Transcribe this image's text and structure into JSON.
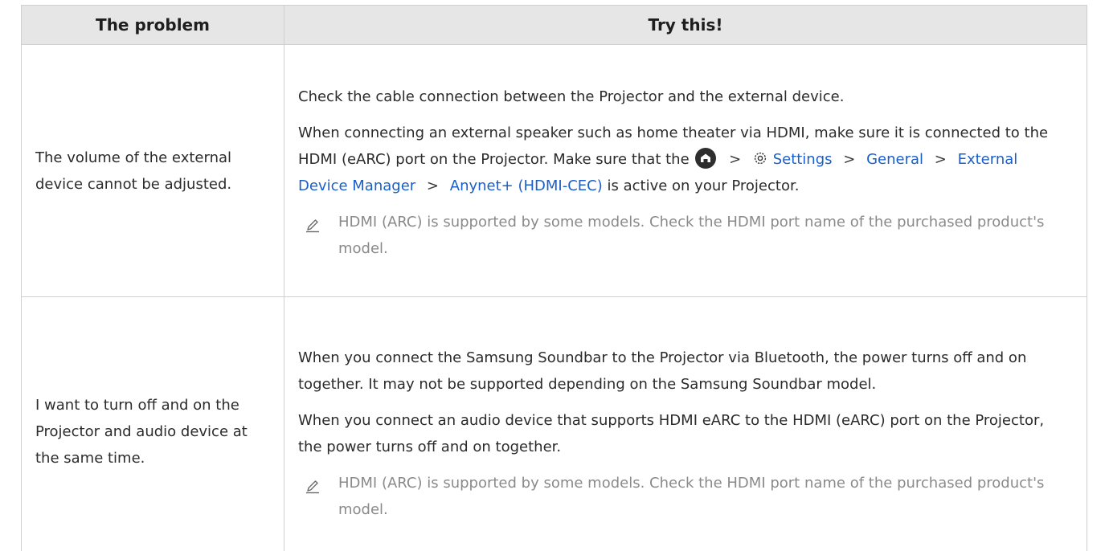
{
  "header": {
    "problem": "The problem",
    "solution": "Try this!"
  },
  "rows": [
    {
      "problem": "The volume of the external device cannot be adjusted.",
      "p1": "Check the cable connection between the Projector and the external device.",
      "p2_prefix": "When connecting an external speaker such as home theater via HDMI, make sure it is connected to the HDMI (eARC) port on the Projector. Make sure that the",
      "sep": ">",
      "path": [
        "Settings",
        "General",
        "External Device Manager",
        "Anynet+ (HDMI-CEC)"
      ],
      "p2_suffix": "is active on your Projector.",
      "note": "HDMI (ARC) is supported by some models. Check the HDMI port name of the purchased product's model."
    },
    {
      "problem": "I want to turn off and on the Projector and audio device at the same time.",
      "p1": "When you connect the Samsung Soundbar to the Projector via Bluetooth, the power turns off and on together. It may not be supported depending on the Samsung Soundbar model.",
      "p2": "When you connect an audio device that supports HDMI eARC to the HDMI (eARC) port on the Projector, the power turns off and on together.",
      "note": "HDMI (ARC) is supported by some models. Check the HDMI port name of the purchased product's model."
    }
  ],
  "icons": {
    "home": "home-icon",
    "settings": "settings-gear-icon",
    "note": "pencil-note-icon"
  },
  "colors": {
    "link": "#1a5fc9",
    "header_bg": "#e6e6e6",
    "note_text": "#8a8a8a"
  }
}
